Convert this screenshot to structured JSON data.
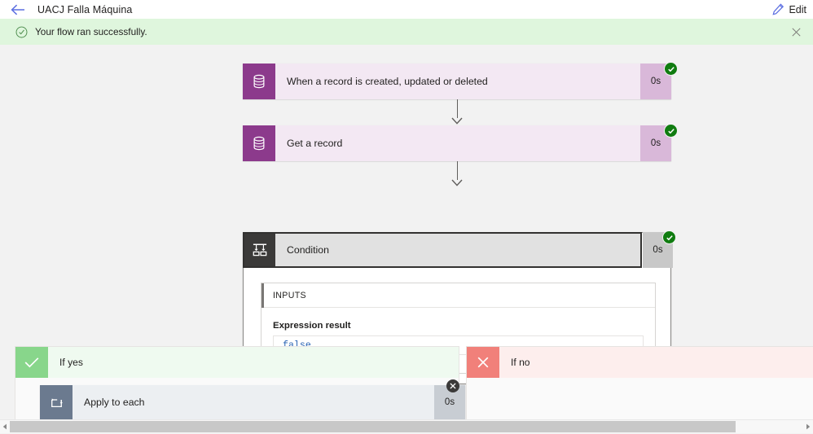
{
  "header": {
    "back_icon": "arrow-left-icon",
    "title": "UACJ Falla Máquina",
    "edit_label": "Edit",
    "edit_icon": "pencil-icon"
  },
  "banner": {
    "icon": "check-circle-icon",
    "message": "Your flow ran successfully.",
    "close_icon": "close-icon",
    "background": "#dff6dd"
  },
  "flow": {
    "steps": [
      {
        "name": "When a record is created, updated or deleted",
        "duration": "0s",
        "icon": "database-icon",
        "status": "succeeded",
        "status_icon": "check-circle-icon",
        "accent": "#8c3a8c"
      },
      {
        "name": "Get a record",
        "duration": "0s",
        "icon": "database-icon",
        "status": "succeeded",
        "status_icon": "check-circle-icon",
        "accent": "#8c3a8c"
      }
    ],
    "condition": {
      "name": "Condition",
      "duration": "0s",
      "icon": "condition-branch-icon",
      "status": "succeeded",
      "status_icon": "check-circle-icon",
      "accent": "#3b3a39",
      "selected": true,
      "inputs": {
        "section_label": "INPUTS",
        "field_label": "Expression result",
        "value": "false",
        "value_color": "#2a64b4"
      }
    },
    "branches": [
      {
        "label": "If yes",
        "icon": "check-icon",
        "accent": "#88d68b",
        "actions": [
          {
            "name": "Apply to each",
            "duration": "0s",
            "icon": "loop-icon",
            "accent": "#6b7a8f",
            "close_icon": "close-circle-icon"
          }
        ]
      },
      {
        "label": "If no",
        "icon": "cross-icon",
        "accent": "#f1807a",
        "actions": []
      }
    ]
  },
  "scrollbar": {
    "left_arrow_icon": "triangle-left-icon",
    "right_arrow_icon": "triangle-right-icon",
    "orientation": "horizontal"
  }
}
